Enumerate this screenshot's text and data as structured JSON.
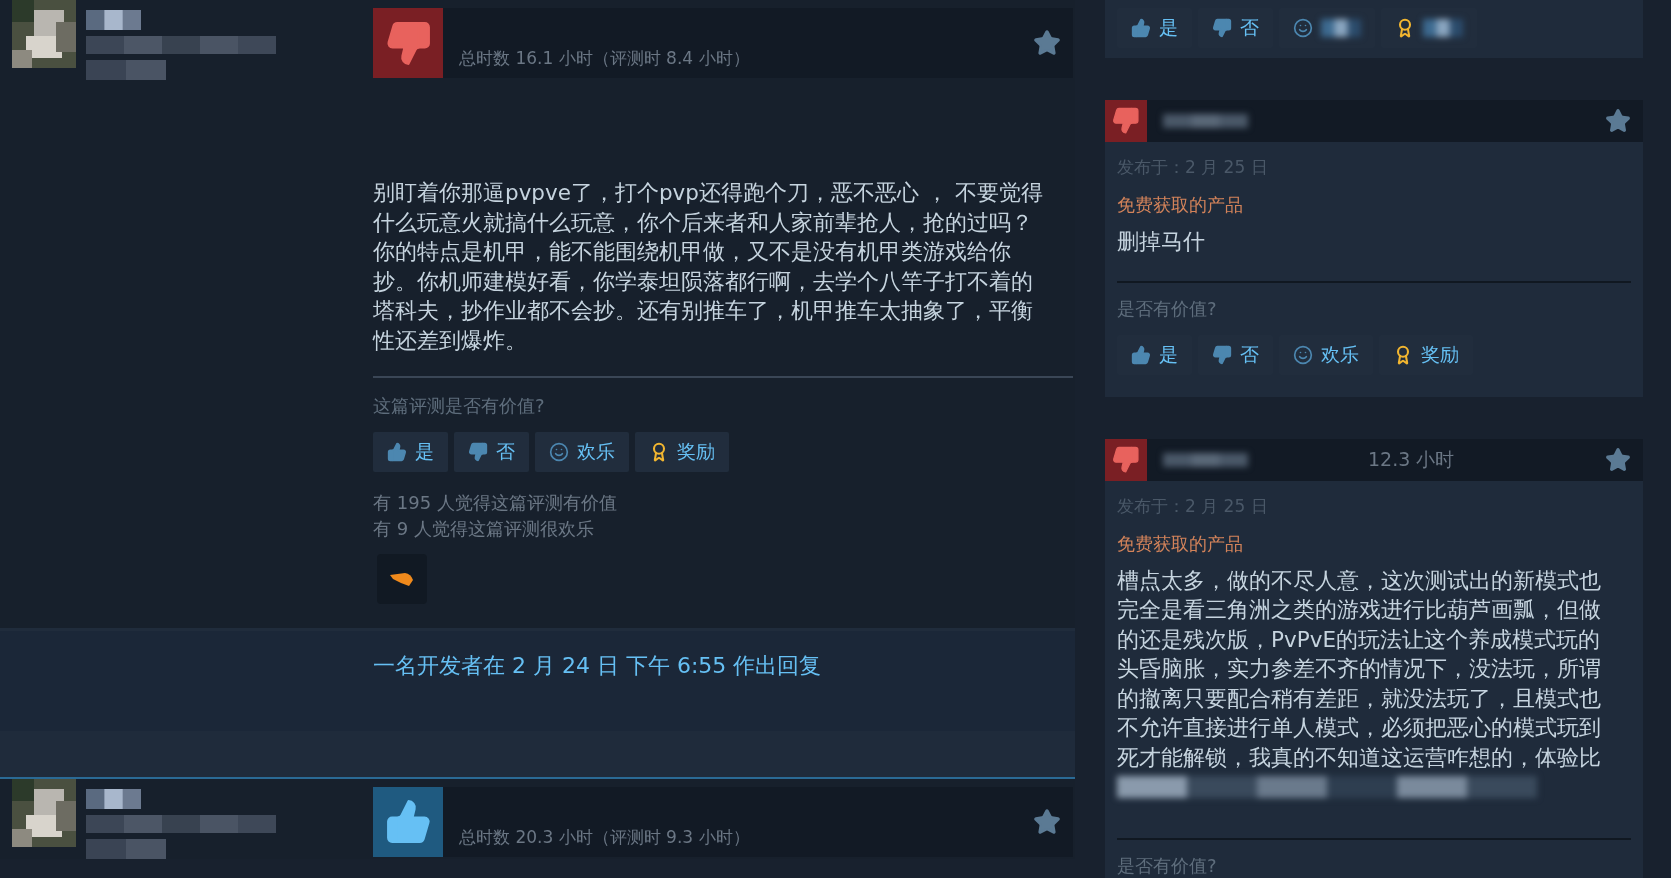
{
  "reviews": [
    {
      "recommended": false,
      "hours": "总时数 16.1 小时（评测时 8.4 小时）",
      "text": "别盯着你那逼pvpve了，打个pvp还得跑个刀，恶不恶心 ， 不要觉得什么玩意火就搞什么玩意，你个后来者和人家前辈抢人，抢的过吗？你的特点是机甲，能不能围绕机甲做，又不是没有机甲类游戏给你抄。你机师建模好看，你学泰坦陨落都行啊，去学个八竿子打不着的塔科夫，抄作业都不会抄。还有别推车了，机甲推车太抽象了，平衡性还差到爆炸。",
      "helpful_prompt": "这篇评测是否有价值?",
      "vote_buttons": [
        {
          "kind": "yes",
          "label": "是"
        },
        {
          "kind": "no",
          "label": "否"
        },
        {
          "kind": "funny",
          "label": "欢乐"
        },
        {
          "kind": "award",
          "label": "奖励"
        }
      ],
      "helpful_count": "有 195 人觉得这篇评测有价值",
      "funny_count": "有 9 人觉得这篇评测很欢乐",
      "developer_reply": "一名开发者在 2 月 24 日 下午 6:55 作出回复"
    },
    {
      "recommended": true,
      "hours": "总时数 20.3 小时（评测时 9.3 小时）"
    }
  ],
  "side_reviews": [
    {
      "vote_buttons": [
        {
          "kind": "yes",
          "label": "是"
        },
        {
          "kind": "no",
          "label": "否"
        },
        {
          "kind": "funny"
        },
        {
          "kind": "award"
        }
      ]
    },
    {
      "recommended": false,
      "date": "发布于：2 月 25 日",
      "product_note": "免费获取的产品",
      "text": "删掉马什",
      "helpful_prompt": "是否有价值?",
      "vote_buttons": [
        {
          "kind": "yes",
          "label": "是"
        },
        {
          "kind": "no",
          "label": "否"
        },
        {
          "kind": "funny",
          "label": "欢乐"
        },
        {
          "kind": "award",
          "label": "奖励"
        }
      ]
    },
    {
      "recommended": false,
      "hours": "12.3 小时",
      "date": "发布于：2 月 25 日",
      "product_note": "免费获取的产品",
      "text": "槽点太多，做的不尽人意，这次测试出的新模式也完全是看三角洲之类的游戏进行比葫芦画瓢，但做的还是残次版，PvPvE的玩法让这个养成模式玩的头昏脑胀，实力参差不齐的情况下，没法玩，所谓的撤离只要配合稍有差距，就没法玩了，且模式也不允许直接进行单人模式，必须把恶心的模式玩到死才能解锁，我真的不知道这运营咋想的，体验比",
      "helpful_prompt": "是否有价值?"
    }
  ]
}
